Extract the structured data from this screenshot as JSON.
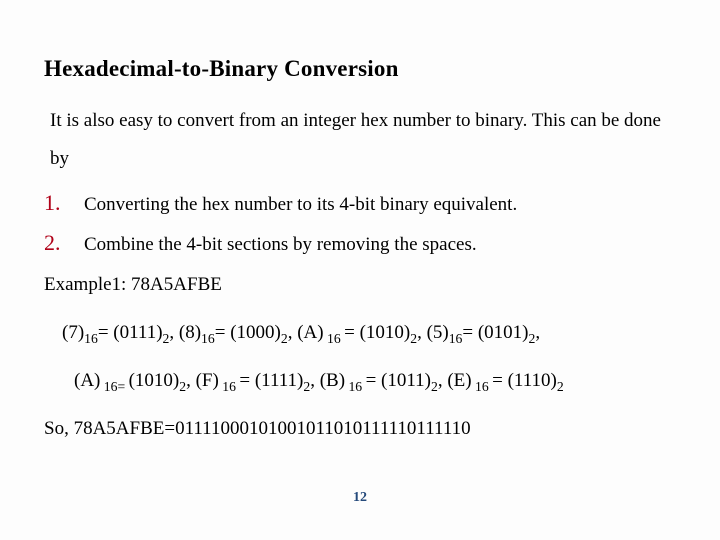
{
  "title": "Hexadecimal-to-Binary Conversion",
  "intro": "It is also easy to convert from an integer hex number to binary. This can be done by",
  "steps": {
    "n1": "1.",
    "t1": "Converting the hex number to its 4-bit binary equivalent.",
    "n2": "2.",
    "t2": "Combine the 4-bit sections by removing the spaces."
  },
  "example_label": "Example1: 78A5AFBE",
  "conv": {
    "d7": "(7)",
    "s16a": "16",
    "eq": "= ",
    "b0111": "(0111)",
    "s2": "2",
    "comma": ", ",
    "d8": "(8)",
    "b1000": "(1000)",
    "dA": "(A)",
    "sp16": " 16 ",
    "eqsp": " = ",
    "b1010": "(1010)",
    "d5": "(5)",
    "b0101": "(0101)",
    "dA2": "(A)",
    "sp16eq": " 16= ",
    "dF": "(F)",
    "b1111": "(1111)",
    "dB": "(B)",
    "b1011": "(1011)",
    "dE": "(E)",
    "b1110": "(1110)"
  },
  "result": "So, 78A5AFBE=01111000101001011010111110111110",
  "page": "12"
}
